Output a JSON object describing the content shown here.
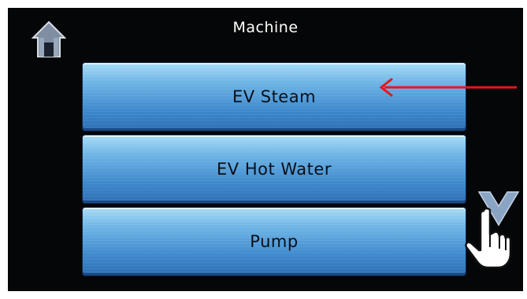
{
  "header": {
    "title": "Machine",
    "home_icon": "home-icon"
  },
  "menu": {
    "items": [
      {
        "label": "EV Steam"
      },
      {
        "label": "EV Hot Water"
      },
      {
        "label": "Pump"
      }
    ]
  },
  "controls": {
    "scroll_down_icon": "chevron-down-icon"
  },
  "annotations": {
    "arrow_icon": "red-arrow-left-icon",
    "arrow_color": "#e8151b",
    "hand_icon": "pointing-hand-icon"
  },
  "colors": {
    "screen_bg": "#050607",
    "button_top": "#a7dcf6",
    "button_bottom": "#2d6fb4",
    "chevron": "#8aa4c4"
  }
}
